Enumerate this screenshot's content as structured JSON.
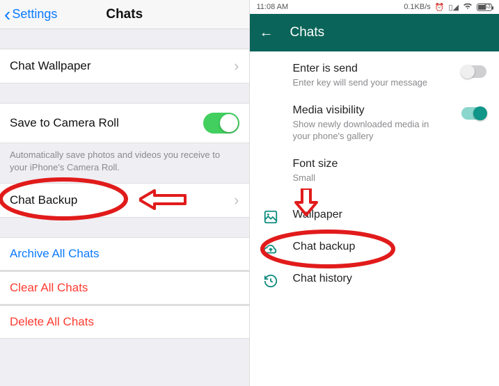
{
  "ios": {
    "back_label": "Settings",
    "title": "Chats",
    "chat_wallpaper": "Chat Wallpaper",
    "save_camera_roll": "Save to Camera Roll",
    "save_camera_roll_on": true,
    "save_note": "Automatically save photos and videos you receive to your iPhone's Camera Roll.",
    "chat_backup": "Chat Backup",
    "archive_all": "Archive All Chats",
    "clear_all": "Clear All Chats",
    "delete_all": "Delete All Chats"
  },
  "android": {
    "status_time": "11:08 AM",
    "data_rate": "0.1KB/s",
    "battery_text": "53",
    "title": "Chats",
    "enter_is_send": {
      "label": "Enter is send",
      "sub": "Enter key will send your message",
      "on": false
    },
    "media_visibility": {
      "label": "Media visibility",
      "sub": "Show newly downloaded media in your phone's gallery",
      "on": true
    },
    "font_size": {
      "label": "Font size",
      "value": "Small"
    },
    "wallpaper": "Wallpaper",
    "chat_backup": "Chat backup",
    "chat_history": "Chat history"
  },
  "annotations": {
    "ellipse_color": "#e11b1b",
    "arrow_color": "#e11b1b"
  }
}
